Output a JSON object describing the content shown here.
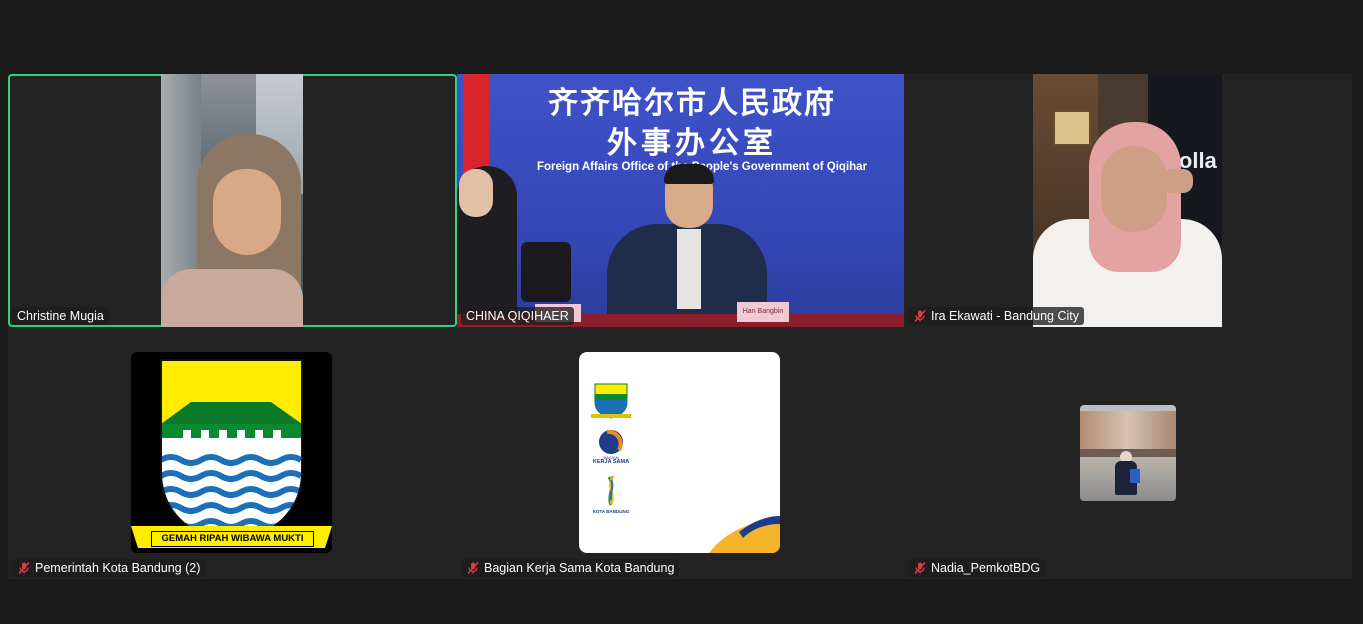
{
  "participants": [
    {
      "name": "Christine Mugia",
      "muted": false,
      "active": true
    },
    {
      "name": "CHINA QIQIHAER",
      "muted": false,
      "active": false
    },
    {
      "name": "Ira Ekawati - Bandung City",
      "muted": true,
      "active": false
    },
    {
      "name": "Pemerintah Kota Bandung (2)",
      "muted": true,
      "active": false
    },
    {
      "name": "Bagian Kerja Sama Kota Bandung",
      "muted": true,
      "active": false
    },
    {
      "name": "Nadia_PemkotBDG",
      "muted": true,
      "active": false
    }
  ],
  "qiqihar_banner": {
    "line1": "齐齐哈尔市人民政府",
    "line2": "外事办公室",
    "english": "Foreign Affairs Office of the People's Government of Qiqihar",
    "nameplate": "Han Bangbin"
  },
  "bandung_crest": {
    "motto": "GEMAH RIPAH WIBAWA MUKTI"
  },
  "kerjasama_logo": {
    "label1": "BAGIAN",
    "label2": "KERJA SAMA",
    "label3": "KOTA BANDUNG"
  },
  "ira_background_text": "Colla",
  "colors": {
    "active_border": "#2fd37f",
    "mute_icon": "#e0383e",
    "background": "#1a1a1a",
    "tile": "#232323"
  }
}
